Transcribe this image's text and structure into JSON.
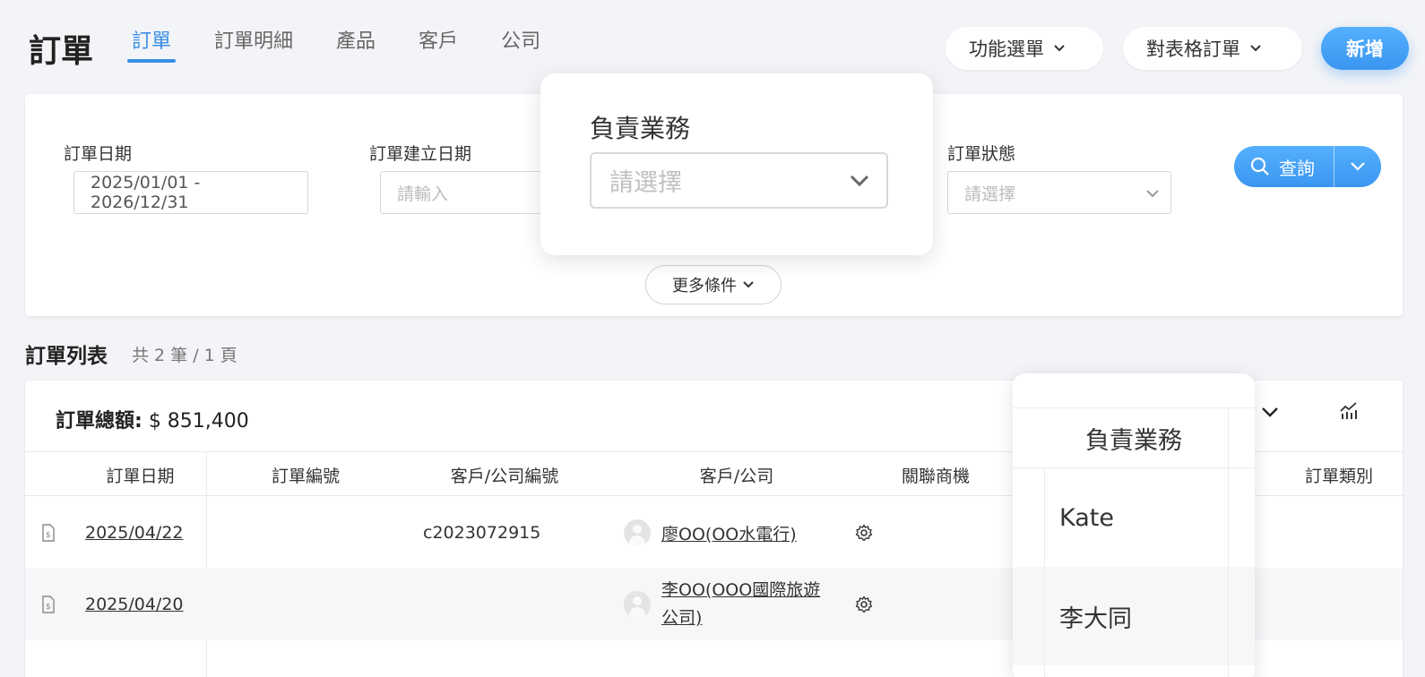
{
  "header": {
    "title": "訂單",
    "tabs": [
      "訂單",
      "訂單明細",
      "產品",
      "客戶",
      "公司"
    ],
    "function_menu": "功能選單",
    "table_orders": "對表格訂單",
    "new_button": "新增"
  },
  "filters": {
    "order_date_label": "訂單日期",
    "order_date_value": "2025/01/01 - 2026/12/31",
    "created_date_label": "訂單建立日期",
    "created_date_placeholder": "請輸入",
    "status_label": "訂單狀態",
    "status_placeholder": "請選擇",
    "query_button": "查詢",
    "more_button": "更多條件"
  },
  "popover": {
    "label": "負責業務",
    "placeholder": "請選擇"
  },
  "list": {
    "title": "訂單列表",
    "count": "共 2 筆 / 1 頁",
    "total_label": "訂單總額:",
    "total_value": "$ 851,400",
    "columns": [
      "訂單日期",
      "訂單編號",
      "客戶/公司編號",
      "客戶/公司",
      "關聯商機",
      "訂單類別"
    ],
    "rows": [
      {
        "date": "2025/04/22",
        "order_no": "",
        "customer_no": "c2023072915",
        "customer_line1": "廖OO(OO水電行)",
        "customer_line2": ""
      },
      {
        "date": "2025/04/20",
        "order_no": "",
        "customer_no": "",
        "customer_line1": "李OO(OOO國際旅遊",
        "customer_line2": "公司)"
      }
    ]
  },
  "sales_column": {
    "header": "負責業務",
    "values": [
      "Kate",
      "李大同"
    ]
  },
  "colors": {
    "accent": "#3a8ee6",
    "background": "#f3f4f7"
  }
}
